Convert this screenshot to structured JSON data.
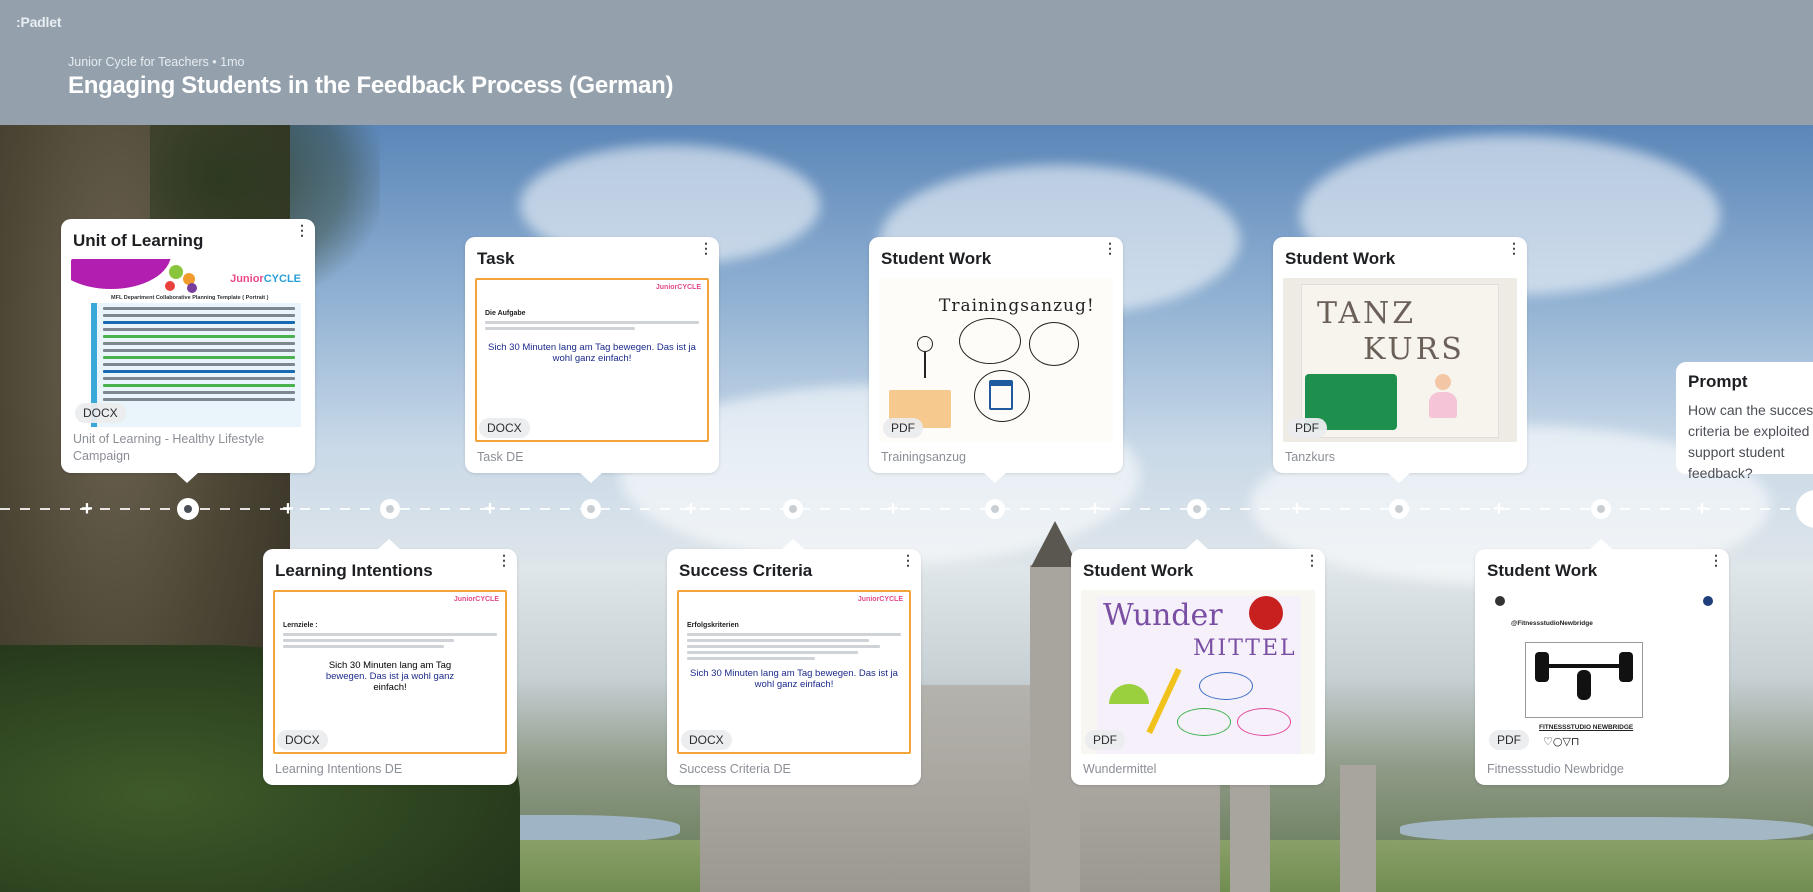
{
  "header": {
    "logo": ":Padlet",
    "meta": "Junior Cycle for Teachers • 1mo",
    "title": "Engaging Students in the Feedback Process (German)"
  },
  "cards_top": [
    {
      "title": "Unit of Learning",
      "badge": "DOCX",
      "caption": "Unit of Learning - Healthy Lifestyle Campaign"
    },
    {
      "title": "Task",
      "badge": "DOCX",
      "caption": "Task DE",
      "doc_heading": "Die Aufgabe",
      "doc_emph": "Sich 30 Minuten lang am Tag bewegen. Das ist ja wohl ganz einfach!"
    },
    {
      "title": "Student Work",
      "badge": "PDF",
      "caption": "Trainingsanzug",
      "sketch_title": "Trainingsanzug!"
    },
    {
      "title": "Student Work",
      "badge": "PDF",
      "caption": "Tanzkurs",
      "sketch_title_1": "TANZ",
      "sketch_title_2": "KURS"
    }
  ],
  "cards_bottom": [
    {
      "title": "Learning Intentions",
      "badge": "DOCX",
      "caption": "Learning Intentions DE",
      "doc_heading": "Lernziele :",
      "doc_emph_1": "Sich 30 Minuten lang am Tag",
      "doc_emph_2": "bewegen. Das ist ja wohl ganz",
      "doc_emph_3": "einfach!"
    },
    {
      "title": "Success Criteria",
      "badge": "DOCX",
      "caption": "Success Criteria DE",
      "doc_heading": "Erfolgskriterien",
      "doc_emph": "Sich 30 Minuten lang am Tag bewegen. Das ist ja wohl ganz einfach!"
    },
    {
      "title": "Student Work",
      "badge": "PDF",
      "caption": "Wundermittel",
      "sketch_title_1": "Wunder",
      "sketch_title_2": "MITTEL"
    },
    {
      "title": "Student Work",
      "badge": "PDF",
      "caption": "Fitnessstudio Newbridge",
      "sketch_handle": "@FitnessstudioNewbridge",
      "sketch_title": "FITNESSSTUDIO NEWBRIDGE",
      "sketch_icons": "♡○▽⊓"
    }
  ],
  "prompt": {
    "title": "Prompt",
    "body": "How can the success criteria be exploited to support student feedback?"
  },
  "unit_doc": {
    "logo_prefix": "Junior",
    "logo_accent": "CYCLE",
    "doc_title": "MFL Department Collaborative Planning Template ( Portrait )"
  },
  "junior_cycle_label": "JuniorCYCLE"
}
